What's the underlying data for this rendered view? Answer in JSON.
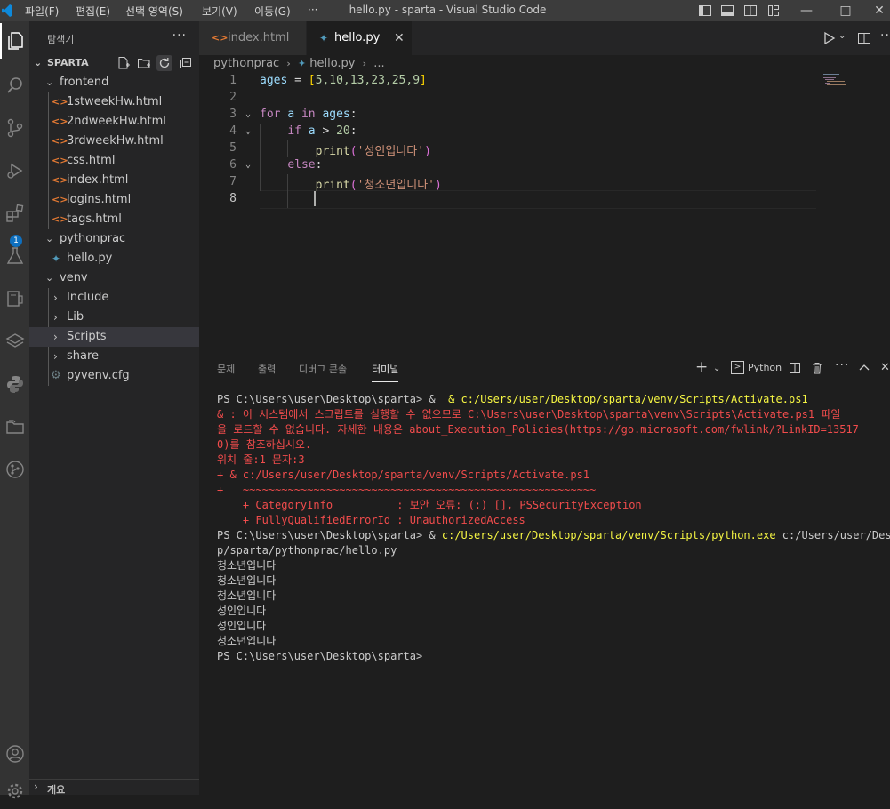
{
  "titlebar": {
    "menus": [
      "파일(F)",
      "편집(E)",
      "선택 영역(S)",
      "보기(V)",
      "이동(G)",
      "···"
    ],
    "title": "hello.py - sparta - Visual Studio Code"
  },
  "activity_badge": "1",
  "sidebar": {
    "title": "탐색기",
    "more": "···",
    "root": "SPARTA",
    "items": [
      {
        "label": "frontend",
        "type": "folder"
      },
      {
        "label": "1stweekHw.html",
        "type": "html"
      },
      {
        "label": "2ndweekHw.html",
        "type": "html"
      },
      {
        "label": "3rdweekHw.html",
        "type": "html"
      },
      {
        "label": "css.html",
        "type": "html"
      },
      {
        "label": "index.html",
        "type": "html"
      },
      {
        "label": "logins.html",
        "type": "html"
      },
      {
        "label": "tags.html",
        "type": "html"
      },
      {
        "label": "pythonprac",
        "type": "folder"
      },
      {
        "label": "hello.py",
        "type": "py"
      },
      {
        "label": "venv",
        "type": "folder"
      },
      {
        "label": "Include",
        "type": "folder-closed"
      },
      {
        "label": "Lib",
        "type": "folder-closed"
      },
      {
        "label": "Scripts",
        "type": "folder-closed",
        "selected": true
      },
      {
        "label": "share",
        "type": "folder-closed"
      },
      {
        "label": "pyvenv.cfg",
        "type": "cfg"
      }
    ],
    "outline": "개요"
  },
  "tabs": [
    {
      "label": "index.html",
      "active": false
    },
    {
      "label": "hello.py",
      "active": true
    }
  ],
  "breadcrumb": {
    "folder": "pythonprac",
    "file": "hello.py",
    "rest": "..."
  },
  "editor": {
    "line_numbers": [
      "1",
      "2",
      "3",
      "4",
      "5",
      "6",
      "7",
      "8"
    ],
    "current_line": "8",
    "code": {
      "l1_var": "ages",
      "l1_eq": " = ",
      "l1_open": "[",
      "l1_nums": "5,10,13,23,25,9",
      "l1_close": "]",
      "l3_for": "for",
      "l3_a": "a",
      "l3_in": "in",
      "l3_ages": "ages",
      "l3_colon": ":",
      "l4_if": "if",
      "l4_a": "a",
      "l4_gt": " > ",
      "l4_num": "20",
      "l4_colon": ":",
      "l5_print": "print",
      "l5_open": "(",
      "l5_str": "'성인입니다'",
      "l5_close": ")",
      "l6_else": "else",
      "l6_colon": ":",
      "l7_print": "print",
      "l7_open": "(",
      "l7_str": "'청소년입니다'",
      "l7_close": ")"
    }
  },
  "panel": {
    "tabs": [
      "문제",
      "출력",
      "디버그 콘솔",
      "터미널"
    ],
    "active_tab": "터미널",
    "shell_label": "Python",
    "terminal": {
      "prompt": "PS C:\\Users\\user\\Desktop\\sparta>",
      "cmd1": " & c:/Users/user/Desktop/sparta/venv/Scripts/Activate.ps1",
      "err1": "& : 이 시스템에서 스크립트를 실행할 수 없으므로 C:\\Users\\user\\Desktop\\sparta\\venv\\Scripts\\Activate.ps1 파일",
      "err2a": "을 로드할 수 없습니다. 자세한 내용은 ",
      "err2b": "about_Execution_Policies(https://go.microsoft.com/fwlink/?LinkID=13517",
      "err3": "0)를 참조하십시오.",
      "err4": "위치 줄:1 문자:3",
      "err5": "+ & c:/Users/user/Desktop/sparta/venv/Scripts/Activate.ps1",
      "err6": "+   ~~~~~~~~~~~~~~~~~~~~~~~~~~~~~~~~~~~~~~~~~~~~~~~~~~~~~~~",
      "err7": "    + CategoryInfo          : 보안 오류: (:) [], PSSecurityException",
      "err8": "    + FullyQualifiedErrorId : UnauthorizedAccess",
      "cmd2_amp": " & ",
      "cmd2_exe": "c:/Users/user/Desktop/sparta/venv/Scripts/python.exe",
      "cmd2_arg": " c:/Users/user/Desktop/sparta/pythonprac/hello.py",
      "cmd2_arg_line1": " c:/Users/user/Deskto",
      "cmd2_arg_line2": "p/sparta/pythonprac/hello.py",
      "outputs": [
        "청소년입니다",
        "청소년입니다",
        "청소년입니다",
        "성인입니다",
        "성인입니다",
        "청소년입니다"
      ],
      "final_prompt": "PS C:\\Users\\user\\Desktop\\sparta>"
    }
  }
}
